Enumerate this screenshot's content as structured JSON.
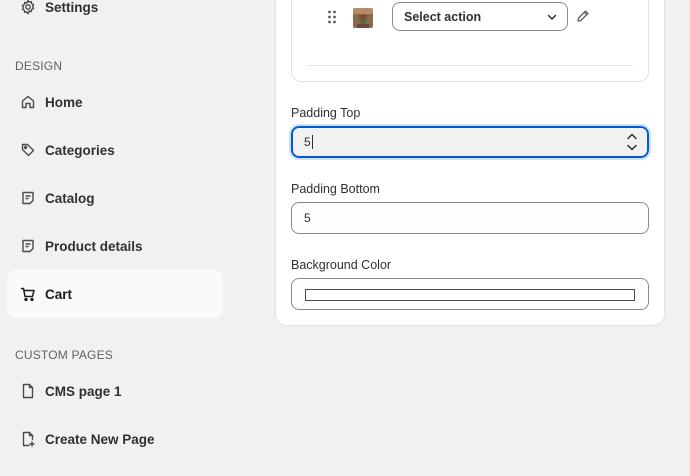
{
  "sidebar": {
    "top_item": {
      "label": "Settings",
      "icon": "gear-icon"
    },
    "design_title": "DESIGN",
    "design_items": [
      {
        "label": "Home",
        "icon": "home-icon"
      },
      {
        "label": "Categories",
        "icon": "tag-icon"
      },
      {
        "label": "Catalog",
        "icon": "catalog-icon"
      },
      {
        "label": "Product details",
        "icon": "product-details-icon"
      },
      {
        "label": "Cart",
        "icon": "cart-icon",
        "active": true
      }
    ],
    "custom_title": "CUSTOM PAGES",
    "custom_items": [
      {
        "label": "CMS page 1",
        "icon": "page-icon"
      },
      {
        "label": "Create New Page",
        "icon": "add-page-icon"
      }
    ]
  },
  "block": {
    "action_select": {
      "value": "Select action"
    }
  },
  "fields": {
    "padding_top": {
      "label": "Padding Top",
      "value": "5"
    },
    "padding_bottom": {
      "label": "Padding Bottom",
      "value": "5"
    },
    "background_color": {
      "label": "Background Color",
      "value": "#ffffff"
    }
  },
  "colors": {
    "focus_border": "#005bd3",
    "sidebar_bg": "#f1f1f1",
    "card_bg": "#ffffff"
  }
}
